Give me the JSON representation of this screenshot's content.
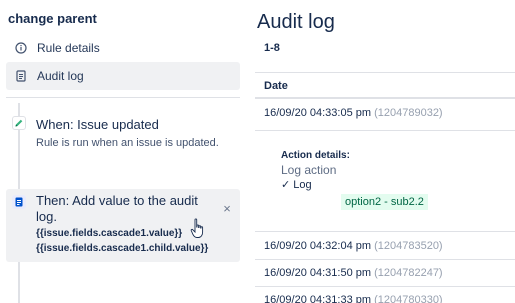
{
  "sidebar": {
    "rule_name": "change parent",
    "nav": [
      {
        "label": "Rule details",
        "icon": "info-icon"
      },
      {
        "label": "Audit log",
        "icon": "document-icon"
      }
    ],
    "when": {
      "title": "When: Issue updated",
      "subtitle": "Rule is run when an issue is updated.",
      "icon": "pencil-icon"
    },
    "then": {
      "title": "Then: Add value to the audit log.",
      "code_line1": "{{issue.fields.cascade1.value}}",
      "code_line2": "{{issue.fields.cascade1.child.value}}",
      "icon": "audit-document-icon",
      "close": "×"
    }
  },
  "main": {
    "title": "Audit log",
    "range": "1-8",
    "column_header": "Date",
    "entries": [
      {
        "date": "16/09/20 04:33:05 pm",
        "id": "(1204789032)"
      },
      {
        "date": "16/09/20 04:32:04 pm",
        "id": "(1204783520)"
      },
      {
        "date": "16/09/20 04:31:50 pm",
        "id": "(1204782247)"
      },
      {
        "date": "16/09/20 04:31:33 pm",
        "id": "(1204780330)"
      }
    ],
    "details": {
      "title": "Action details:",
      "action": "Log action",
      "log_label": "Log",
      "check": "✓",
      "value": "option2 - sub2.2"
    }
  },
  "colors": {
    "accent": "#0052cc",
    "success_bg": "#e3fcef",
    "success_text": "#006644",
    "active_bg": "#f0f1f3"
  }
}
